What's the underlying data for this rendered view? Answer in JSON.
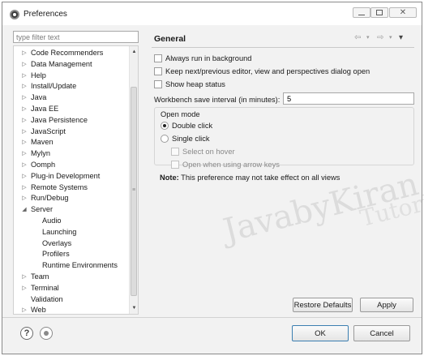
{
  "window": {
    "title": "Preferences",
    "min_glyph": "",
    "max_glyph": "",
    "close_glyph": "✕"
  },
  "sidebar": {
    "filter_placeholder": "type filter text",
    "items": [
      {
        "label": "Code Recommenders",
        "arrow": "▷",
        "level": 0
      },
      {
        "label": "Data Management",
        "arrow": "▷",
        "level": 0
      },
      {
        "label": "Help",
        "arrow": "▷",
        "level": 0
      },
      {
        "label": "Install/Update",
        "arrow": "▷",
        "level": 0
      },
      {
        "label": "Java",
        "arrow": "▷",
        "level": 0
      },
      {
        "label": "Java EE",
        "arrow": "▷",
        "level": 0
      },
      {
        "label": "Java Persistence",
        "arrow": "▷",
        "level": 0
      },
      {
        "label": "JavaScript",
        "arrow": "▷",
        "level": 0
      },
      {
        "label": "Maven",
        "arrow": "▷",
        "level": 0
      },
      {
        "label": "Mylyn",
        "arrow": "▷",
        "level": 0
      },
      {
        "label": "Oomph",
        "arrow": "▷",
        "level": 0
      },
      {
        "label": "Plug-in Development",
        "arrow": "▷",
        "level": 0
      },
      {
        "label": "Remote Systems",
        "arrow": "▷",
        "level": 0
      },
      {
        "label": "Run/Debug",
        "arrow": "▷",
        "level": 0
      },
      {
        "label": "Server",
        "arrow": "◢",
        "level": 0
      },
      {
        "label": "Audio",
        "arrow": "",
        "level": 1
      },
      {
        "label": "Launching",
        "arrow": "",
        "level": 1
      },
      {
        "label": "Overlays",
        "arrow": "",
        "level": 1
      },
      {
        "label": "Profilers",
        "arrow": "",
        "level": 1
      },
      {
        "label": "Runtime Environments",
        "arrow": "",
        "level": 1
      },
      {
        "label": "Team",
        "arrow": "▷",
        "level": 0
      },
      {
        "label": "Terminal",
        "arrow": "▷",
        "level": 0
      },
      {
        "label": "Validation",
        "arrow": "",
        "level": 0
      },
      {
        "label": "Web",
        "arrow": "▷",
        "level": 0
      }
    ]
  },
  "page": {
    "title": "General",
    "nav": {
      "back": "⇦",
      "forward": "⇨",
      "dropdown": "▾",
      "menu": "▾"
    },
    "checkboxes": [
      {
        "label": "Always run in background",
        "checked": false
      },
      {
        "label": "Keep next/previous editor, view and perspectives dialog open",
        "checked": false
      },
      {
        "label": "Show heap status",
        "checked": false
      }
    ],
    "interval_label": "Workbench save interval (in minutes):",
    "interval_value": "5",
    "open_mode": {
      "title": "Open mode",
      "options": [
        {
          "label": "Double click",
          "selected": true
        },
        {
          "label": "Single click",
          "selected": false
        }
      ],
      "sub_options": [
        {
          "label": "Select on hover",
          "enabled": false
        },
        {
          "label": "Open when using arrow keys",
          "enabled": false
        }
      ],
      "note_bold": "Note:",
      "note_text": " This preference may not take effect on all views"
    },
    "restore_label": "Restore Defaults",
    "apply_label": "Apply"
  },
  "watermark": {
    "main": "JavabyKiran",
    "sub": "Tutorials"
  },
  "footer": {
    "help_glyph": "?",
    "ok_label": "OK",
    "cancel_label": "Cancel"
  }
}
